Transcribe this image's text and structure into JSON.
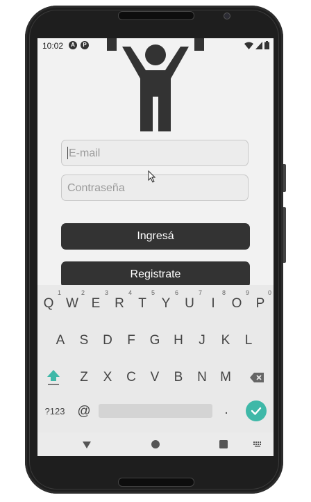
{
  "status_bar": {
    "time": "10:02",
    "badge_a": "A",
    "badge_b": "P"
  },
  "form": {
    "email_placeholder": "E-mail",
    "password_placeholder": "Contraseña",
    "login_label": "Ingresá",
    "register_label": "Registrate"
  },
  "keyboard": {
    "row1": [
      "Q",
      "W",
      "E",
      "R",
      "T",
      "Y",
      "U",
      "I",
      "O",
      "P"
    ],
    "row1_hints": [
      "1",
      "2",
      "3",
      "4",
      "5",
      "6",
      "7",
      "8",
      "9",
      "0"
    ],
    "row2": [
      "A",
      "S",
      "D",
      "F",
      "G",
      "H",
      "J",
      "K",
      "L"
    ],
    "row3": [
      "Z",
      "X",
      "C",
      "V",
      "B",
      "N",
      "M"
    ],
    "symbols_label": "?123",
    "at_label": "@",
    "period_label": "."
  },
  "colors": {
    "accent": "#3fb8a8",
    "button": "#333333",
    "screen_bg": "#f2f2f2"
  }
}
